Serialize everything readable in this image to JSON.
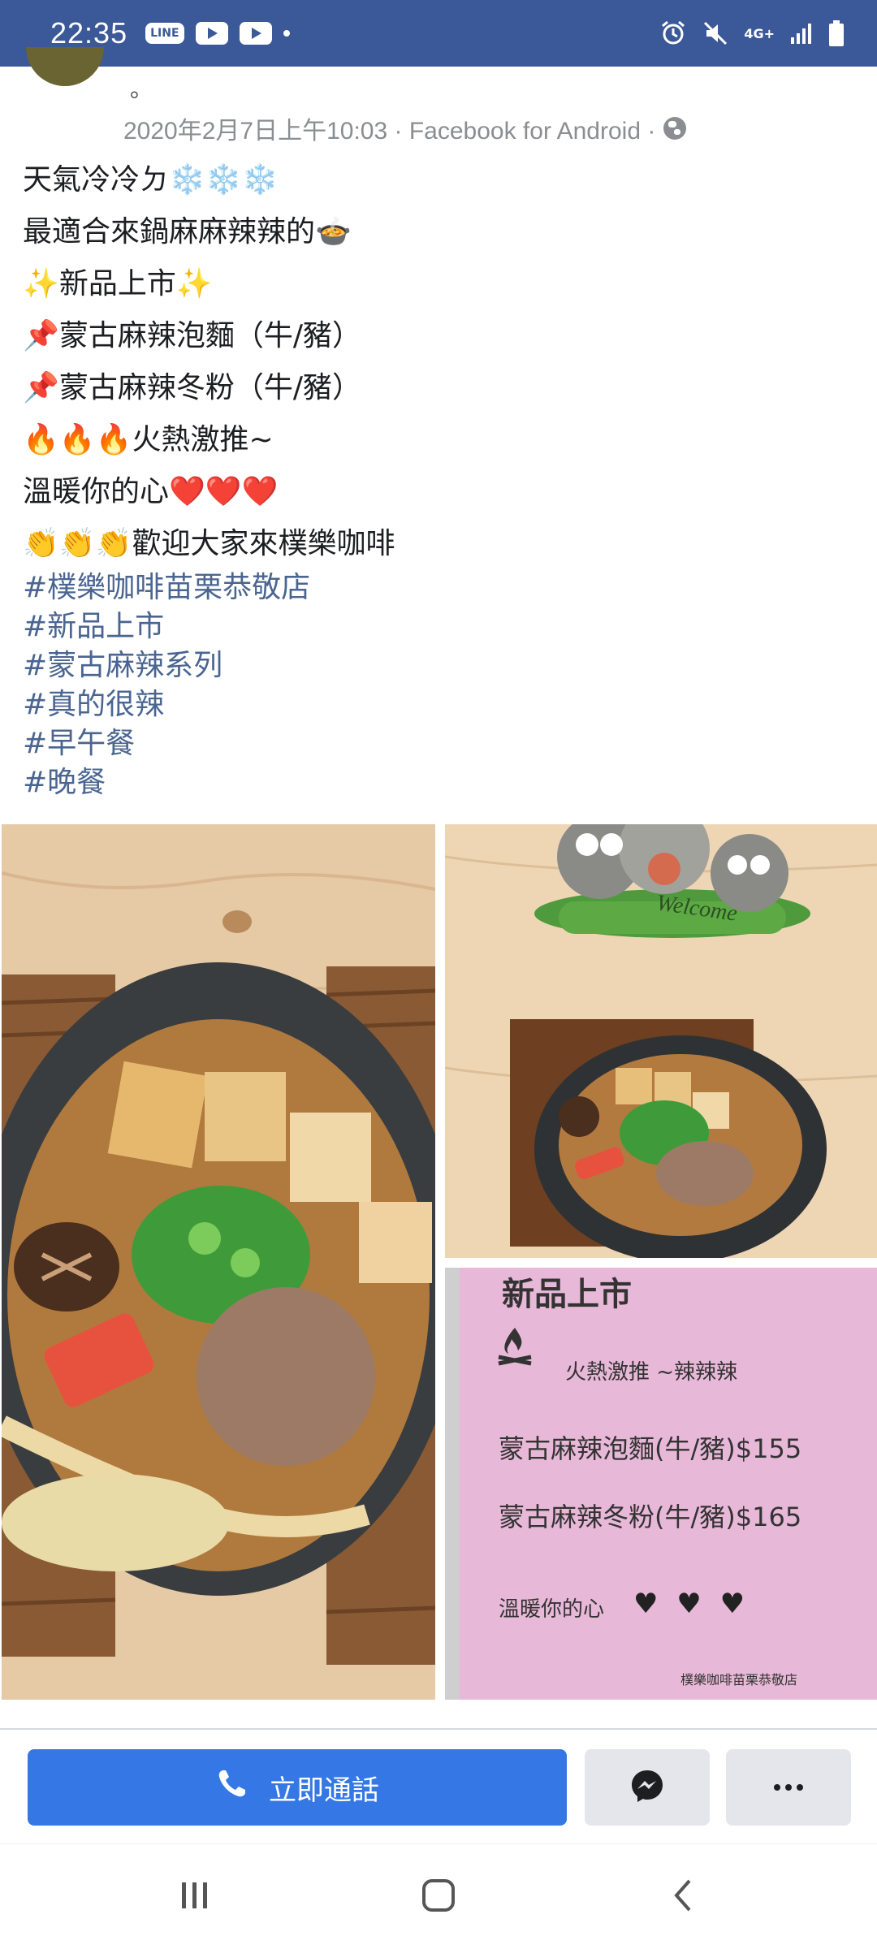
{
  "status_bar": {
    "time": "22:35",
    "left_icons": [
      "line-icon",
      "youtube-icon",
      "youtube-icon",
      "notification-dot-icon"
    ],
    "right_icons": [
      "alarm-icon",
      "mute-icon",
      "4g-icon",
      "signal-icon",
      "battery-icon"
    ],
    "network_label": "4G+",
    "app_chip": "LINE"
  },
  "post": {
    "name_tail": "。",
    "meta_text": "2020年2月7日上午10:03 · Facebook for Android ·",
    "lines": [
      "天氣冷冷ㄉ❄️❄️❄️",
      "最適合來鍋麻麻辣辣的🍲",
      "✨新品上市✨",
      "📌蒙古麻辣泡麵（牛/豬）",
      "📌蒙古麻辣冬粉（牛/豬）",
      "🔥🔥🔥火熱激推~",
      "溫暖你的心❤️❤️❤️",
      "👏👏👏歡迎大家來樸樂咖啡"
    ],
    "hashtags": [
      "#樸樂咖啡苗栗恭敬店",
      "#新品上市",
      "#蒙古麻辣系列",
      "#真的很辣",
      "#早午餐",
      "#晚餐"
    ]
  },
  "photos": {
    "menu_sign": {
      "title": "新品上市",
      "subtitle": "火熱激推 ~辣辣辣",
      "item1": "蒙古麻辣泡麵(牛/豬)$155",
      "item2": "蒙古麻辣冬粉(牛/豬)$165",
      "footer": "溫暖你的心",
      "hearts": "♥ ♥ ♥",
      "store": "樸樂咖啡苗栗恭敬店"
    },
    "welcome_sign": "Welcome"
  },
  "action_bar": {
    "call_label": "立即通話",
    "messenger_icon": "messenger-icon",
    "more_icon": "more-icon"
  },
  "colors": {
    "status_bar": "#3b5998",
    "call_button": "#3578e5",
    "hashtag": "#4a6591",
    "meta": "#8a8d91"
  }
}
